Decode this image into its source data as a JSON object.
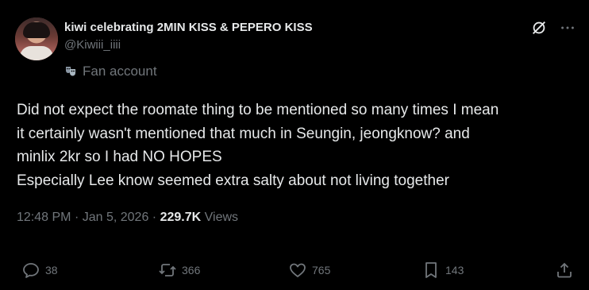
{
  "author": {
    "display_name": "kiwi celebrating 2MIN KISS & PEPERO KISS",
    "handle": "@Kiwiii_iiii",
    "label": "Fan account"
  },
  "tweet": {
    "lines": [
      "Did not expect the roomate thing to be mentioned so many times I mean",
      "it certainly wasn't mentioned that much in Seungin, jeongknow?  and",
      "minlix 2kr so I had NO HOPES",
      "Especially Lee know seemed extra salty about not living together"
    ],
    "time": "12:48 PM",
    "date": "Jan 5, 2026",
    "views_count": "229.7K",
    "views_label": "Views"
  },
  "actions": {
    "replies": "38",
    "reposts": "366",
    "likes": "765",
    "bookmarks": "143"
  },
  "colors": {
    "background": "#000000",
    "text": "#e7e9ea",
    "muted": "#71767b"
  }
}
